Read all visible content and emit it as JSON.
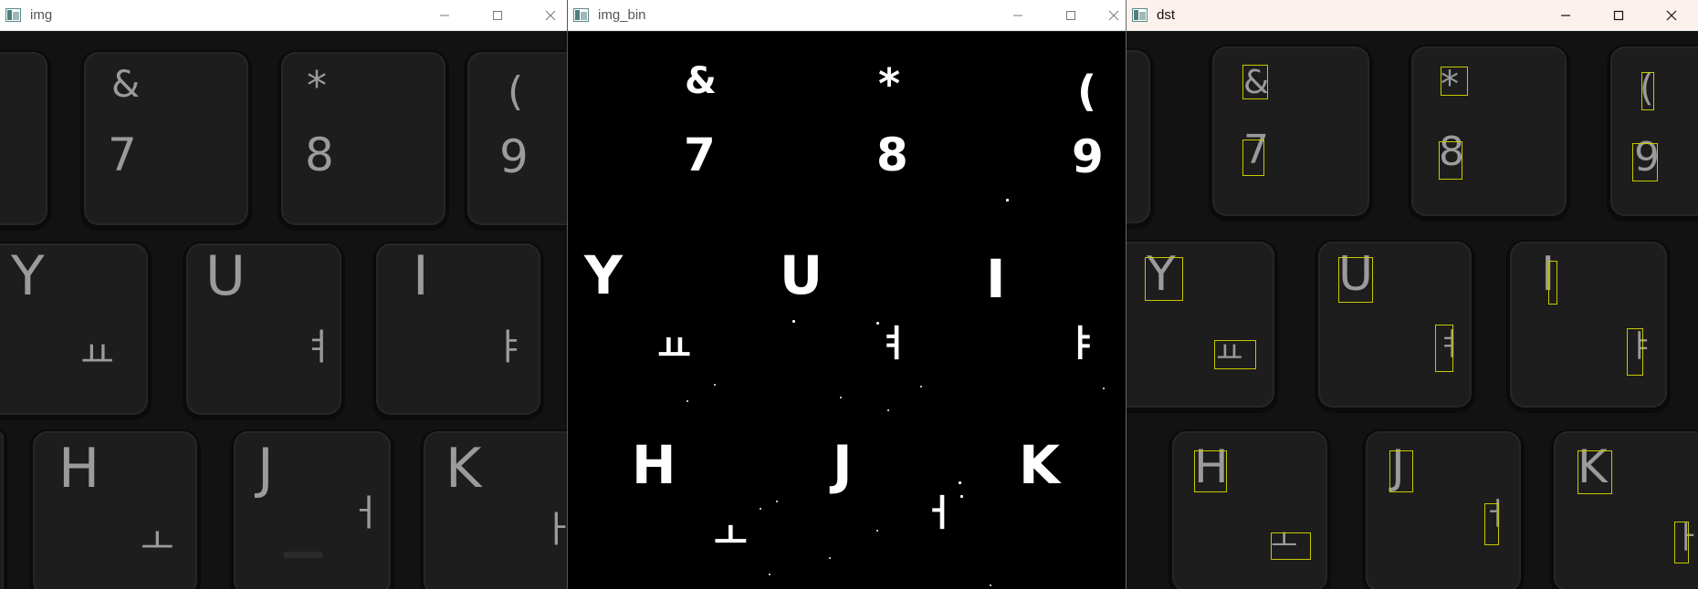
{
  "windows": {
    "img": {
      "title": "img"
    },
    "img_bin": {
      "title": "img_bin"
    },
    "dst": {
      "title": "dst"
    }
  },
  "icons": {
    "app": "opencv-window-icon",
    "minimize": "minimize-icon",
    "maximize": "maximize-icon",
    "close": "close-icon"
  },
  "keyboard": {
    "row1": [
      {
        "top": "&",
        "bottom": "7"
      },
      {
        "top": "*",
        "bottom": "8"
      },
      {
        "top": "(",
        "bottom": "9"
      }
    ],
    "row2": [
      {
        "letter": "Y",
        "hangul": "ㅛ"
      },
      {
        "letter": "U",
        "hangul": "ㅕ"
      },
      {
        "letter": "I",
        "hangul": "ㅑ"
      }
    ],
    "row3": [
      {
        "letter": "H",
        "hangul": "ㅗ"
      },
      {
        "letter": "J",
        "hangul": "ㅓ"
      },
      {
        "letter": "K",
        "hangul": "ㅏ"
      }
    ]
  },
  "colors": {
    "detection_box": "#c8c800",
    "binary_foreground": "#ffffff",
    "binary_background": "#000000"
  }
}
